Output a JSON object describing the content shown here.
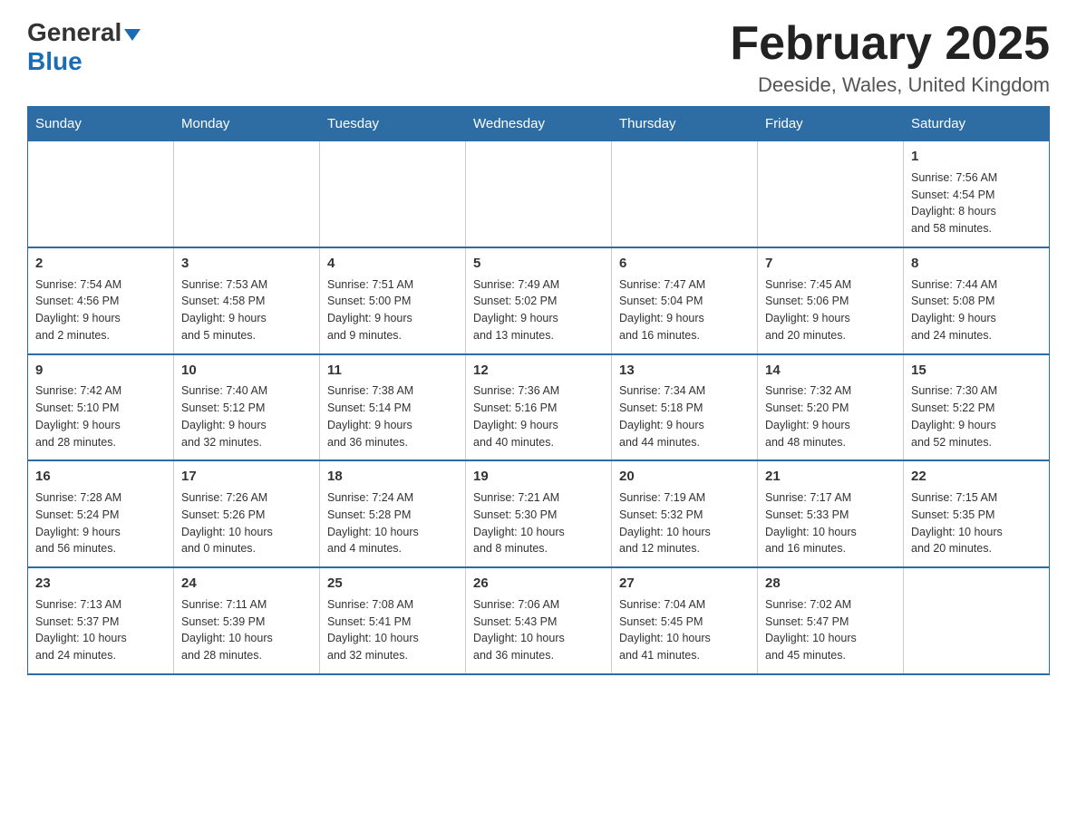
{
  "logo": {
    "general": "General",
    "blue": "Blue"
  },
  "header": {
    "title": "February 2025",
    "location": "Deeside, Wales, United Kingdom"
  },
  "weekdays": [
    "Sunday",
    "Monday",
    "Tuesday",
    "Wednesday",
    "Thursday",
    "Friday",
    "Saturday"
  ],
  "weeks": [
    {
      "days": [
        {
          "number": "",
          "info": "",
          "empty": true
        },
        {
          "number": "",
          "info": "",
          "empty": true
        },
        {
          "number": "",
          "info": "",
          "empty": true
        },
        {
          "number": "",
          "info": "",
          "empty": true
        },
        {
          "number": "",
          "info": "",
          "empty": true
        },
        {
          "number": "",
          "info": "",
          "empty": true
        },
        {
          "number": "1",
          "info": "Sunrise: 7:56 AM\nSunset: 4:54 PM\nDaylight: 8 hours\nand 58 minutes.",
          "empty": false
        }
      ]
    },
    {
      "days": [
        {
          "number": "2",
          "info": "Sunrise: 7:54 AM\nSunset: 4:56 PM\nDaylight: 9 hours\nand 2 minutes.",
          "empty": false
        },
        {
          "number": "3",
          "info": "Sunrise: 7:53 AM\nSunset: 4:58 PM\nDaylight: 9 hours\nand 5 minutes.",
          "empty": false
        },
        {
          "number": "4",
          "info": "Sunrise: 7:51 AM\nSunset: 5:00 PM\nDaylight: 9 hours\nand 9 minutes.",
          "empty": false
        },
        {
          "number": "5",
          "info": "Sunrise: 7:49 AM\nSunset: 5:02 PM\nDaylight: 9 hours\nand 13 minutes.",
          "empty": false
        },
        {
          "number": "6",
          "info": "Sunrise: 7:47 AM\nSunset: 5:04 PM\nDaylight: 9 hours\nand 16 minutes.",
          "empty": false
        },
        {
          "number": "7",
          "info": "Sunrise: 7:45 AM\nSunset: 5:06 PM\nDaylight: 9 hours\nand 20 minutes.",
          "empty": false
        },
        {
          "number": "8",
          "info": "Sunrise: 7:44 AM\nSunset: 5:08 PM\nDaylight: 9 hours\nand 24 minutes.",
          "empty": false
        }
      ]
    },
    {
      "days": [
        {
          "number": "9",
          "info": "Sunrise: 7:42 AM\nSunset: 5:10 PM\nDaylight: 9 hours\nand 28 minutes.",
          "empty": false
        },
        {
          "number": "10",
          "info": "Sunrise: 7:40 AM\nSunset: 5:12 PM\nDaylight: 9 hours\nand 32 minutes.",
          "empty": false
        },
        {
          "number": "11",
          "info": "Sunrise: 7:38 AM\nSunset: 5:14 PM\nDaylight: 9 hours\nand 36 minutes.",
          "empty": false
        },
        {
          "number": "12",
          "info": "Sunrise: 7:36 AM\nSunset: 5:16 PM\nDaylight: 9 hours\nand 40 minutes.",
          "empty": false
        },
        {
          "number": "13",
          "info": "Sunrise: 7:34 AM\nSunset: 5:18 PM\nDaylight: 9 hours\nand 44 minutes.",
          "empty": false
        },
        {
          "number": "14",
          "info": "Sunrise: 7:32 AM\nSunset: 5:20 PM\nDaylight: 9 hours\nand 48 minutes.",
          "empty": false
        },
        {
          "number": "15",
          "info": "Sunrise: 7:30 AM\nSunset: 5:22 PM\nDaylight: 9 hours\nand 52 minutes.",
          "empty": false
        }
      ]
    },
    {
      "days": [
        {
          "number": "16",
          "info": "Sunrise: 7:28 AM\nSunset: 5:24 PM\nDaylight: 9 hours\nand 56 minutes.",
          "empty": false
        },
        {
          "number": "17",
          "info": "Sunrise: 7:26 AM\nSunset: 5:26 PM\nDaylight: 10 hours\nand 0 minutes.",
          "empty": false
        },
        {
          "number": "18",
          "info": "Sunrise: 7:24 AM\nSunset: 5:28 PM\nDaylight: 10 hours\nand 4 minutes.",
          "empty": false
        },
        {
          "number": "19",
          "info": "Sunrise: 7:21 AM\nSunset: 5:30 PM\nDaylight: 10 hours\nand 8 minutes.",
          "empty": false
        },
        {
          "number": "20",
          "info": "Sunrise: 7:19 AM\nSunset: 5:32 PM\nDaylight: 10 hours\nand 12 minutes.",
          "empty": false
        },
        {
          "number": "21",
          "info": "Sunrise: 7:17 AM\nSunset: 5:33 PM\nDaylight: 10 hours\nand 16 minutes.",
          "empty": false
        },
        {
          "number": "22",
          "info": "Sunrise: 7:15 AM\nSunset: 5:35 PM\nDaylight: 10 hours\nand 20 minutes.",
          "empty": false
        }
      ]
    },
    {
      "days": [
        {
          "number": "23",
          "info": "Sunrise: 7:13 AM\nSunset: 5:37 PM\nDaylight: 10 hours\nand 24 minutes.",
          "empty": false
        },
        {
          "number": "24",
          "info": "Sunrise: 7:11 AM\nSunset: 5:39 PM\nDaylight: 10 hours\nand 28 minutes.",
          "empty": false
        },
        {
          "number": "25",
          "info": "Sunrise: 7:08 AM\nSunset: 5:41 PM\nDaylight: 10 hours\nand 32 minutes.",
          "empty": false
        },
        {
          "number": "26",
          "info": "Sunrise: 7:06 AM\nSunset: 5:43 PM\nDaylight: 10 hours\nand 36 minutes.",
          "empty": false
        },
        {
          "number": "27",
          "info": "Sunrise: 7:04 AM\nSunset: 5:45 PM\nDaylight: 10 hours\nand 41 minutes.",
          "empty": false
        },
        {
          "number": "28",
          "info": "Sunrise: 7:02 AM\nSunset: 5:47 PM\nDaylight: 10 hours\nand 45 minutes.",
          "empty": false
        },
        {
          "number": "",
          "info": "",
          "empty": true
        }
      ]
    }
  ]
}
